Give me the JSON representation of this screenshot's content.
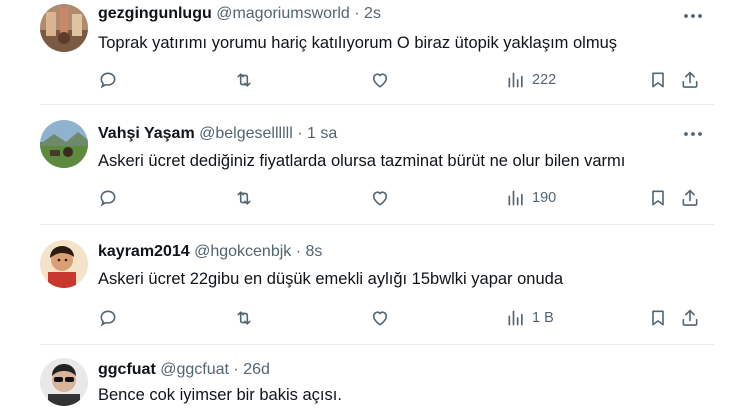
{
  "tweets": [
    {
      "name": "gezgingunlugu",
      "handle": "@magoriumsworld",
      "sep": "·",
      "time": "2s",
      "text": "Toprak yatırımı yorumu hariç katılıyorum O biraz ütopik yaklaşım olmuş",
      "views": "222"
    },
    {
      "name": "Vahşi Yaşam",
      "handle": "@belgesellllll",
      "sep": "·",
      "time": "1 sa",
      "text": "Askeri ücret dediğiniz fiyatlarda olursa tazminat  bürüt ne olur bilen varmı",
      "views": "190"
    },
    {
      "name": "kayram2014",
      "handle": "@hgokcenbjk",
      "sep": "·",
      "time": "8s",
      "text": "Askeri ücret 22gibu en düşük emekli aylığı 15bwlki yapar onuda",
      "views": "1 B"
    },
    {
      "name": "ggcfuat",
      "handle": "@ggcfuat",
      "sep": "·",
      "time": "26d",
      "text": "Bence cok iyimser bir bakis açısı.",
      "views": ""
    }
  ],
  "icons": {
    "reply": "reply-icon",
    "retweet": "retweet-icon",
    "like": "heart-icon",
    "views": "views-icon",
    "bookmark": "bookmark-icon",
    "share": "share-icon",
    "more": "more-icon"
  },
  "colors": {
    "text": "#0f1419",
    "secondary": "#536471",
    "divider": "#e6ecf0"
  }
}
